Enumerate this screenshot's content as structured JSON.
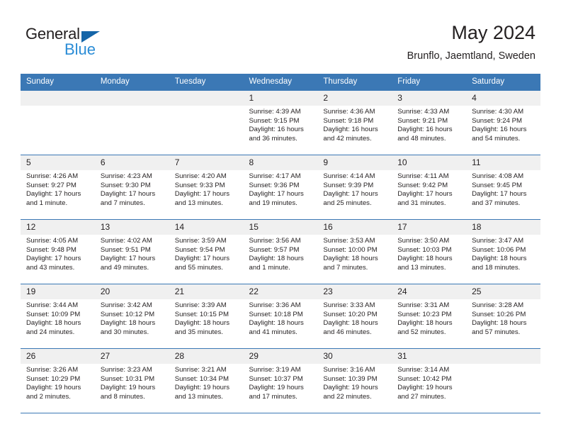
{
  "brand": {
    "name_part1": "General",
    "name_part2": "Blue",
    "triangle_color": "#1565a8",
    "blue_color": "#2a8cd6"
  },
  "header": {
    "title": "May 2024",
    "subtitle": "Brunflo, Jaemtland, Sweden"
  },
  "theme": {
    "header_bg": "#3b78b5",
    "daynum_bg": "#f0f0f0",
    "text": "#231f20"
  },
  "calendar": {
    "weekday_headers": [
      "Sunday",
      "Monday",
      "Tuesday",
      "Wednesday",
      "Thursday",
      "Friday",
      "Saturday"
    ],
    "weeks": [
      [
        {
          "day": "",
          "sunrise": "",
          "sunset": "",
          "daylight": "",
          "empty": true
        },
        {
          "day": "",
          "sunrise": "",
          "sunset": "",
          "daylight": "",
          "empty": true
        },
        {
          "day": "",
          "sunrise": "",
          "sunset": "",
          "daylight": "",
          "empty": true
        },
        {
          "day": "1",
          "sunrise": "Sunrise: 4:39 AM",
          "sunset": "Sunset: 9:15 PM",
          "daylight": "Daylight: 16 hours and 36 minutes."
        },
        {
          "day": "2",
          "sunrise": "Sunrise: 4:36 AM",
          "sunset": "Sunset: 9:18 PM",
          "daylight": "Daylight: 16 hours and 42 minutes."
        },
        {
          "day": "3",
          "sunrise": "Sunrise: 4:33 AM",
          "sunset": "Sunset: 9:21 PM",
          "daylight": "Daylight: 16 hours and 48 minutes."
        },
        {
          "day": "4",
          "sunrise": "Sunrise: 4:30 AM",
          "sunset": "Sunset: 9:24 PM",
          "daylight": "Daylight: 16 hours and 54 minutes."
        }
      ],
      [
        {
          "day": "5",
          "sunrise": "Sunrise: 4:26 AM",
          "sunset": "Sunset: 9:27 PM",
          "daylight": "Daylight: 17 hours and 1 minute."
        },
        {
          "day": "6",
          "sunrise": "Sunrise: 4:23 AM",
          "sunset": "Sunset: 9:30 PM",
          "daylight": "Daylight: 17 hours and 7 minutes."
        },
        {
          "day": "7",
          "sunrise": "Sunrise: 4:20 AM",
          "sunset": "Sunset: 9:33 PM",
          "daylight": "Daylight: 17 hours and 13 minutes."
        },
        {
          "day": "8",
          "sunrise": "Sunrise: 4:17 AM",
          "sunset": "Sunset: 9:36 PM",
          "daylight": "Daylight: 17 hours and 19 minutes."
        },
        {
          "day": "9",
          "sunrise": "Sunrise: 4:14 AM",
          "sunset": "Sunset: 9:39 PM",
          "daylight": "Daylight: 17 hours and 25 minutes."
        },
        {
          "day": "10",
          "sunrise": "Sunrise: 4:11 AM",
          "sunset": "Sunset: 9:42 PM",
          "daylight": "Daylight: 17 hours and 31 minutes."
        },
        {
          "day": "11",
          "sunrise": "Sunrise: 4:08 AM",
          "sunset": "Sunset: 9:45 PM",
          "daylight": "Daylight: 17 hours and 37 minutes."
        }
      ],
      [
        {
          "day": "12",
          "sunrise": "Sunrise: 4:05 AM",
          "sunset": "Sunset: 9:48 PM",
          "daylight": "Daylight: 17 hours and 43 minutes."
        },
        {
          "day": "13",
          "sunrise": "Sunrise: 4:02 AM",
          "sunset": "Sunset: 9:51 PM",
          "daylight": "Daylight: 17 hours and 49 minutes."
        },
        {
          "day": "14",
          "sunrise": "Sunrise: 3:59 AM",
          "sunset": "Sunset: 9:54 PM",
          "daylight": "Daylight: 17 hours and 55 minutes."
        },
        {
          "day": "15",
          "sunrise": "Sunrise: 3:56 AM",
          "sunset": "Sunset: 9:57 PM",
          "daylight": "Daylight: 18 hours and 1 minute."
        },
        {
          "day": "16",
          "sunrise": "Sunrise: 3:53 AM",
          "sunset": "Sunset: 10:00 PM",
          "daylight": "Daylight: 18 hours and 7 minutes."
        },
        {
          "day": "17",
          "sunrise": "Sunrise: 3:50 AM",
          "sunset": "Sunset: 10:03 PM",
          "daylight": "Daylight: 18 hours and 13 minutes."
        },
        {
          "day": "18",
          "sunrise": "Sunrise: 3:47 AM",
          "sunset": "Sunset: 10:06 PM",
          "daylight": "Daylight: 18 hours and 18 minutes."
        }
      ],
      [
        {
          "day": "19",
          "sunrise": "Sunrise: 3:44 AM",
          "sunset": "Sunset: 10:09 PM",
          "daylight": "Daylight: 18 hours and 24 minutes."
        },
        {
          "day": "20",
          "sunrise": "Sunrise: 3:42 AM",
          "sunset": "Sunset: 10:12 PM",
          "daylight": "Daylight: 18 hours and 30 minutes."
        },
        {
          "day": "21",
          "sunrise": "Sunrise: 3:39 AM",
          "sunset": "Sunset: 10:15 PM",
          "daylight": "Daylight: 18 hours and 35 minutes."
        },
        {
          "day": "22",
          "sunrise": "Sunrise: 3:36 AM",
          "sunset": "Sunset: 10:18 PM",
          "daylight": "Daylight: 18 hours and 41 minutes."
        },
        {
          "day": "23",
          "sunrise": "Sunrise: 3:33 AM",
          "sunset": "Sunset: 10:20 PM",
          "daylight": "Daylight: 18 hours and 46 minutes."
        },
        {
          "day": "24",
          "sunrise": "Sunrise: 3:31 AM",
          "sunset": "Sunset: 10:23 PM",
          "daylight": "Daylight: 18 hours and 52 minutes."
        },
        {
          "day": "25",
          "sunrise": "Sunrise: 3:28 AM",
          "sunset": "Sunset: 10:26 PM",
          "daylight": "Daylight: 18 hours and 57 minutes."
        }
      ],
      [
        {
          "day": "26",
          "sunrise": "Sunrise: 3:26 AM",
          "sunset": "Sunset: 10:29 PM",
          "daylight": "Daylight: 19 hours and 2 minutes."
        },
        {
          "day": "27",
          "sunrise": "Sunrise: 3:23 AM",
          "sunset": "Sunset: 10:31 PM",
          "daylight": "Daylight: 19 hours and 8 minutes."
        },
        {
          "day": "28",
          "sunrise": "Sunrise: 3:21 AM",
          "sunset": "Sunset: 10:34 PM",
          "daylight": "Daylight: 19 hours and 13 minutes."
        },
        {
          "day": "29",
          "sunrise": "Sunrise: 3:19 AM",
          "sunset": "Sunset: 10:37 PM",
          "daylight": "Daylight: 19 hours and 17 minutes."
        },
        {
          "day": "30",
          "sunrise": "Sunrise: 3:16 AM",
          "sunset": "Sunset: 10:39 PM",
          "daylight": "Daylight: 19 hours and 22 minutes."
        },
        {
          "day": "31",
          "sunrise": "Sunrise: 3:14 AM",
          "sunset": "Sunset: 10:42 PM",
          "daylight": "Daylight: 19 hours and 27 minutes."
        },
        {
          "day": "",
          "sunrise": "",
          "sunset": "",
          "daylight": "",
          "empty": true
        }
      ]
    ]
  }
}
